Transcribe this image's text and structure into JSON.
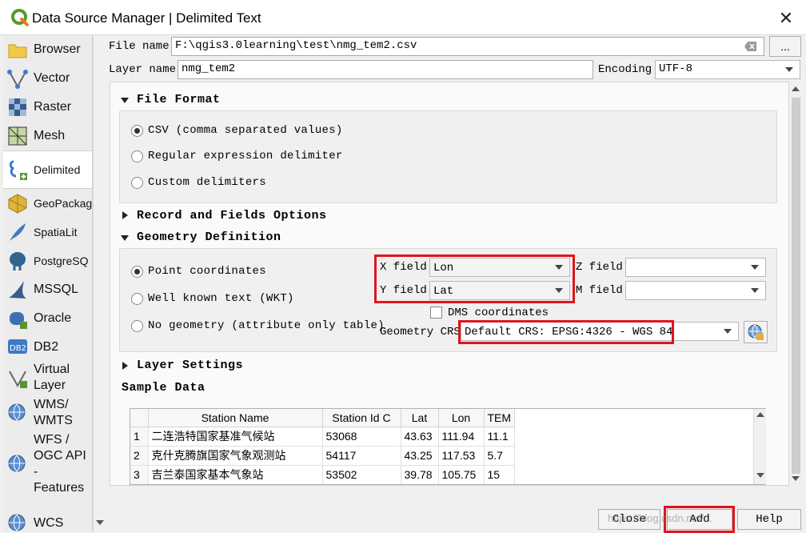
{
  "window": {
    "title": "Data Source Manager | Delimited Text",
    "close_glyph": "✕"
  },
  "sidebar": {
    "items": [
      {
        "label": "Browser"
      },
      {
        "label": "Vector"
      },
      {
        "label": "Raster"
      },
      {
        "label": "Mesh"
      },
      {
        "label": "Delimited"
      },
      {
        "label": "GeoPackag"
      },
      {
        "label": "SpatiaLit"
      },
      {
        "label": "PostgreSQ"
      },
      {
        "label": "MSSQL"
      },
      {
        "label": "Oracle"
      },
      {
        "label": "DB2"
      },
      {
        "label": "Virtual\nLayer"
      },
      {
        "label": "WMS/\nWMTS"
      },
      {
        "label": "WFS /\nOGC API\n-\nFeatures"
      },
      {
        "label": "WCS"
      }
    ],
    "active_index": 4
  },
  "file": {
    "label": "File name",
    "value": "F:\\qgis3.0learning\\test\\nmg_tem2.csv",
    "browse_label": "..."
  },
  "layer": {
    "label": "Layer name",
    "value": "nmg_tem2"
  },
  "encoding": {
    "label": "Encoding",
    "value": "UTF-8"
  },
  "file_format": {
    "title": "File Format",
    "options": [
      {
        "label": "CSV (comma separated values)",
        "checked": true
      },
      {
        "label": "Regular expression delimiter",
        "checked": false
      },
      {
        "label": "Custom delimiters",
        "checked": false
      }
    ]
  },
  "record_fields": {
    "title": "Record and Fields Options"
  },
  "geometry": {
    "title": "Geometry Definition",
    "options": [
      {
        "label": "Point coordinates",
        "checked": true
      },
      {
        "label": "Well known text (WKT)",
        "checked": false
      },
      {
        "label": "No geometry (attribute only table)",
        "checked": false
      }
    ],
    "x_label": "X field",
    "x_value": "Lon",
    "y_label": "Y field",
    "y_value": "Lat",
    "z_label": "Z field",
    "z_value": "",
    "m_label": "M field",
    "m_value": "",
    "dms_label": "DMS coordinates",
    "crs_label": "Geometry CRS",
    "crs_value": "Default CRS: EPSG:4326 - WGS 84"
  },
  "layer_settings": {
    "title": "Layer Settings"
  },
  "sample": {
    "title": "Sample Data",
    "columns": [
      "",
      "Station Name",
      "Station Id C",
      "Lat",
      "Lon",
      "TEM"
    ],
    "rows": [
      [
        "1",
        "二连浩特国家基准气候站",
        "53068",
        "43.63",
        "111.94",
        "11.1"
      ],
      [
        "2",
        "克什克腾旗国家气象观测站",
        "54117",
        "43.25",
        "117.53",
        "5.7"
      ],
      [
        "3",
        "吉兰泰国家基本气象站",
        "53502",
        "39.78",
        "105.75",
        "15"
      ]
    ]
  },
  "buttons": {
    "close": "Close",
    "add": "Add",
    "help": "Help"
  },
  "watermark": "https://blog.csdn.net/...",
  "colors": {
    "highlight": "#e0141e",
    "qgis_green": "#589632"
  }
}
